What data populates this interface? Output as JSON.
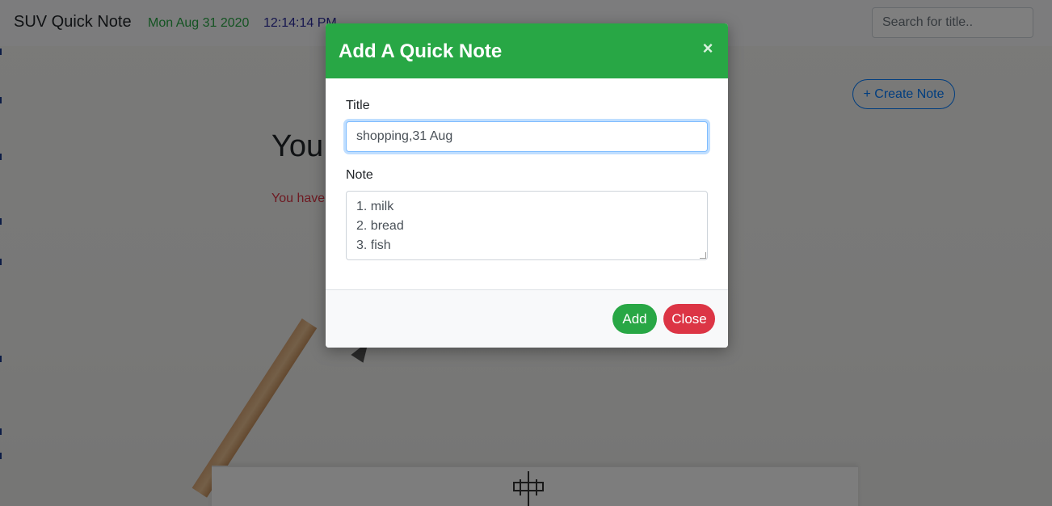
{
  "navbar": {
    "brand": "SUV Quick Note",
    "date": "Mon Aug 31 2020",
    "time": "12:14:14 PM",
    "search_placeholder": "Search for title.."
  },
  "main": {
    "create_button": "+ Create Note",
    "heading": "You",
    "subtext": "You have"
  },
  "modal": {
    "title": "Add A Quick Note",
    "close_symbol": "×",
    "title_label": "Title",
    "title_value": "shopping,31 Aug",
    "note_label": "Note",
    "note_value": "1. milk\n2. bread\n3. fish",
    "add_button": "Add",
    "close_button": "Close"
  },
  "colors": {
    "header_green": "#28a745",
    "danger_red": "#dc3545",
    "primary_blue": "#007bff"
  }
}
